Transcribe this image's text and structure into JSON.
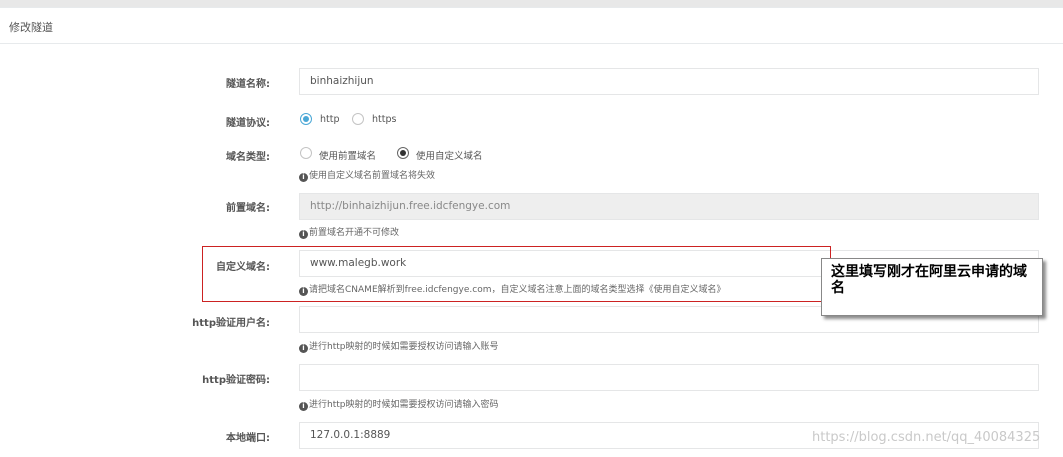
{
  "panel": {
    "title": "修改隧道"
  },
  "form": {
    "tunnel_name": {
      "label": "隧道名称:",
      "value": "binhaizhijun"
    },
    "protocol": {
      "label": "隧道协议:",
      "options": [
        "http",
        "https"
      ],
      "selected": "http"
    },
    "domain_type": {
      "label": "域名类型:",
      "options": [
        "使用前置域名",
        "使用自定义域名"
      ],
      "selected": "使用自定义域名",
      "help": "使用自定义域名前置域名将失效"
    },
    "prefix_domain": {
      "label": "前置域名:",
      "value": "http://binhaizhijun.free.idcfengye.com",
      "help": "前置域名开通不可修改"
    },
    "custom_domain": {
      "label": "自定义域名:",
      "value": "www.malegb.work",
      "help": "请把域名CNAME解析到free.idcfengye.com，自定义域名注意上面的域名类型选择《使用自定义域名》"
    },
    "http_user": {
      "label": "http验证用户名:",
      "value": "",
      "help": "进行http映射的时候如需要授权访问请输入账号"
    },
    "http_password": {
      "label": "http验证密码:",
      "value": "",
      "help": "进行http映射的时候如需要授权访问请输入密码"
    },
    "local_port": {
      "label": "本地端口:",
      "value": "127.0.0.1:8889"
    }
  },
  "annotation": {
    "callout_text": "这里填写刚才在阿里云申请的域名"
  },
  "watermark": "https://blog.csdn.net/qq_40084325",
  "colors": {
    "radio_accent": "#4aa7d6",
    "highlight_border": "#cc2222"
  }
}
